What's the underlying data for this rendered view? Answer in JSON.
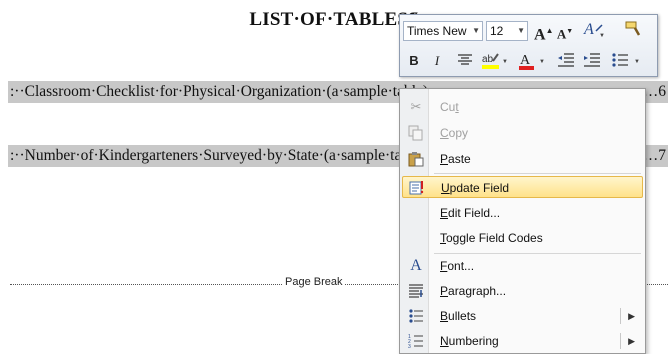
{
  "document": {
    "heading": "LIST·OF·TABLES",
    "heading_mark": "¶",
    "toc_entries": [
      {
        "text": ":··Classroom·Checklist·for·Physical·Organization·(a·sample·table)",
        "tab_mark": "→",
        "page": "………6"
      },
      {
        "text": ":··Number·of·Kindergarteners·Surveyed·by·State·(a·sample·table)",
        "tab_mark": "",
        "page": "………7"
      }
    ],
    "page_break_label": "Page Break"
  },
  "mini_toolbar": {
    "font_name": "Times New",
    "font_size": "12",
    "grow_font": "A",
    "shrink_font": "A",
    "bold": "B",
    "italic": "I",
    "font_color": "A",
    "icons": [
      "grow-font-icon",
      "shrink-font-icon",
      "styles-icon",
      "format-painter-icon",
      "center-align-icon",
      "highlight-icon",
      "font-color-icon",
      "decrease-indent-icon",
      "increase-indent-icon",
      "bullets-icon"
    ],
    "accent_colors": {
      "highlight": "#ffff00",
      "font_color": "#e02020"
    }
  },
  "context_menu": {
    "items": [
      {
        "label": "Cut",
        "mnemonic": "t",
        "icon": "scissors-icon",
        "disabled": true
      },
      {
        "label": "Copy",
        "mnemonic": "C",
        "icon": "copy-icon",
        "disabled": true
      },
      {
        "label": "Paste",
        "mnemonic": "P",
        "icon": "paste-icon",
        "disabled": false
      },
      {
        "label": "Update Field",
        "mnemonic": "U",
        "icon": "update-field-icon",
        "disabled": false,
        "highlighted": true
      },
      {
        "label": "Edit Field...",
        "mnemonic": "E",
        "icon": "",
        "disabled": false
      },
      {
        "label": "Toggle Field Codes",
        "mnemonic": "T",
        "icon": "",
        "disabled": false
      },
      {
        "label": "Font...",
        "mnemonic": "F",
        "icon": "font-icon",
        "disabled": false
      },
      {
        "label": "Paragraph...",
        "mnemonic": "P",
        "icon": "paragraph-icon",
        "disabled": false
      },
      {
        "label": "Bullets",
        "mnemonic": "B",
        "icon": "bullets-icon",
        "disabled": false,
        "submenu": true
      },
      {
        "label": "Numbering",
        "mnemonic": "N",
        "icon": "numbering-icon",
        "disabled": false,
        "submenu": true
      }
    ],
    "highlight_color": "#ffe28a"
  }
}
